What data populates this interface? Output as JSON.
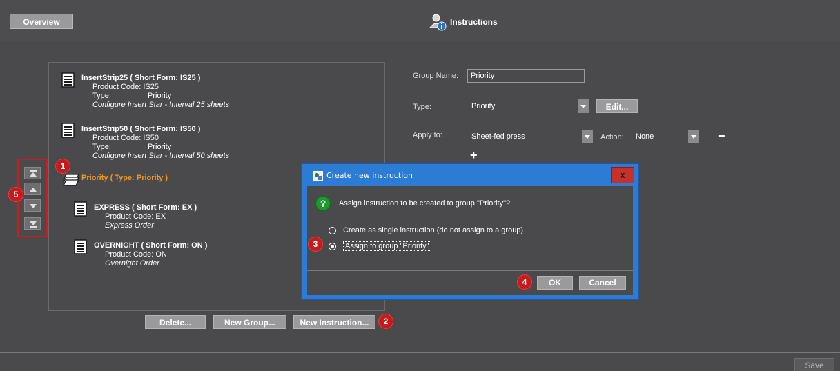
{
  "header": {
    "overview_label": "Overview",
    "title": "Instructions"
  },
  "list": {
    "items": [
      {
        "title": "InsertStrip25 ( Short Form: IS25 )",
        "code": "Product Code: IS25",
        "type_label": "Type:",
        "type_value": "Priority",
        "desc": "Configure Insert Star - Interval 25 sheets"
      },
      {
        "title": "InsertStrip50 ( Short Form: IS50 )",
        "code": "Product Code: IS50",
        "type_label": "Type:",
        "type_value": "Priority",
        "desc": "Configure Insert Star - Interval 50 sheets"
      }
    ],
    "group": {
      "label": "Priority ( Type: Priority )",
      "children": [
        {
          "title": "EXPRESS ( Short Form: EX )",
          "code": "Product Code: EX",
          "desc": "Express Order"
        },
        {
          "title": "OVERNIGHT ( Short Form: ON )",
          "code": "Product Code: ON",
          "desc": "Overnight Order"
        }
      ]
    }
  },
  "actions": {
    "delete_label": "Delete...",
    "new_group_label": "New Group...",
    "new_instruction_label": "New Instruction..."
  },
  "form": {
    "group_name_label": "Group Name:",
    "group_name_value": "Priority",
    "type_label": "Type:",
    "type_value": "Priority",
    "edit_label": "Edit...",
    "apply_to_label": "Apply to:",
    "apply_to_value": "Sheet-fed press",
    "action_label": "Action:",
    "action_value": "None",
    "add_symbol": "+",
    "remove_symbol": "−"
  },
  "dialog": {
    "title": "Create new instruction",
    "close_symbol": "x",
    "question_symbol": "?",
    "question": "Assign instruction to be created to group \"Priority\"?",
    "option_single": "Create as single instruction (do not assign to a group)",
    "option_group": "Assign to group \"Priority\"",
    "selected_option": "option_group",
    "ok_label": "OK",
    "cancel_label": "Cancel"
  },
  "callouts": [
    "1",
    "2",
    "3",
    "4",
    "5"
  ],
  "footer": {
    "save_label": "Save"
  },
  "colors": {
    "background": "#4a4a4d",
    "button": "#9a9a9d",
    "group_highlight": "#f09a1e",
    "callout": "#c41c1c",
    "dialog_frame": "#2c7bd4",
    "close_button": "#c8302a",
    "question_icon": "#1a9a2c"
  },
  "icons": [
    "instructions-icon",
    "document-icon",
    "group-stack-icon",
    "move-top-icon",
    "move-up-icon",
    "move-down-icon",
    "move-bottom-icon",
    "app-icon",
    "question-icon"
  ]
}
